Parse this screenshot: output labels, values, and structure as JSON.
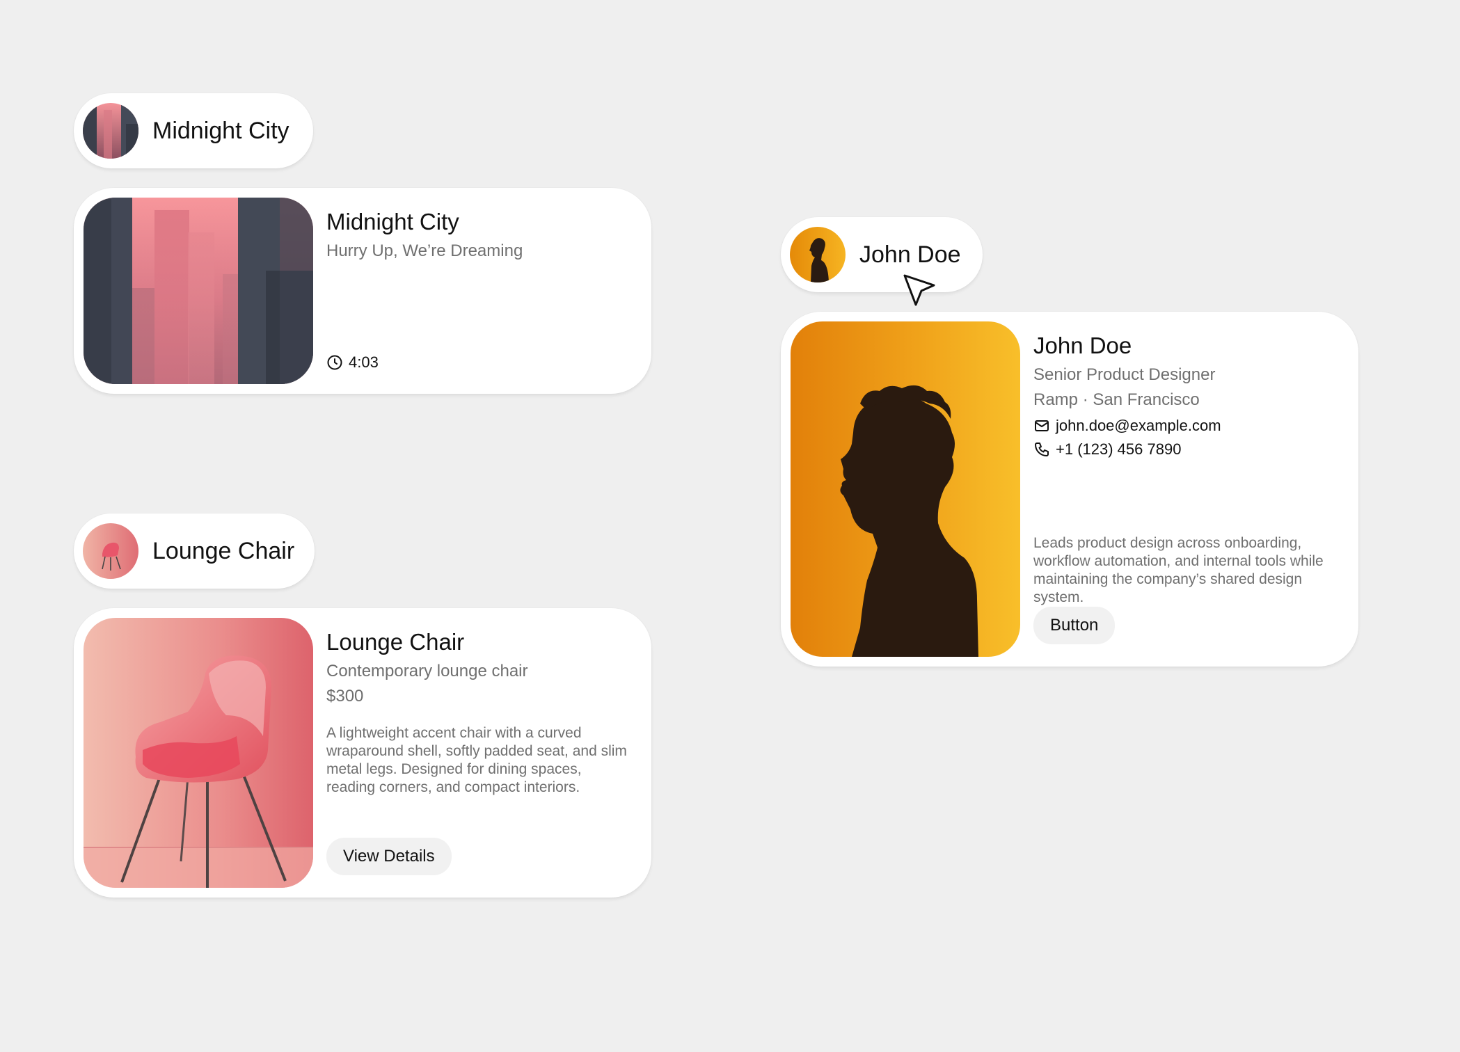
{
  "music": {
    "pill_label": "Midnight City",
    "title": "Midnight City",
    "subtitle": "Hurry Up, We’re Dreaming",
    "duration": "4:03",
    "icons": {
      "duration": "clock-icon"
    }
  },
  "product": {
    "pill_label": "Lounge Chair",
    "title": "Lounge Chair",
    "subtitle": "Contemporary lounge chair",
    "price": "$300",
    "description": "A lightweight accent chair with a curved wraparound shell, softly padded seat, and slim metal legs. Designed for dining spaces, reading corners, and compact interiors.",
    "button_label": "View Details"
  },
  "profile": {
    "pill_label": "John Doe",
    "name": "John Doe",
    "role": "Senior Product Designer",
    "company_location": "Ramp · San Francisco",
    "email": "john.doe@example.com",
    "phone": "+1 (123) 456 7890",
    "bio": "Leads product design across onboarding, workflow automation, and internal tools while maintaining the company’s shared design system.",
    "button_label": "Button",
    "icons": {
      "email": "mail-icon",
      "phone": "phone-icon",
      "pointer": "cursor-arrow-icon"
    }
  },
  "colors": {
    "background": "#efefef",
    "card": "#ffffff",
    "muted_text": "#6f6f6f",
    "button_bg": "#f1f1f1",
    "city_pink": "#f08f94",
    "chair_red": "#e56a70",
    "profile_orange": "#f0a21a"
  }
}
